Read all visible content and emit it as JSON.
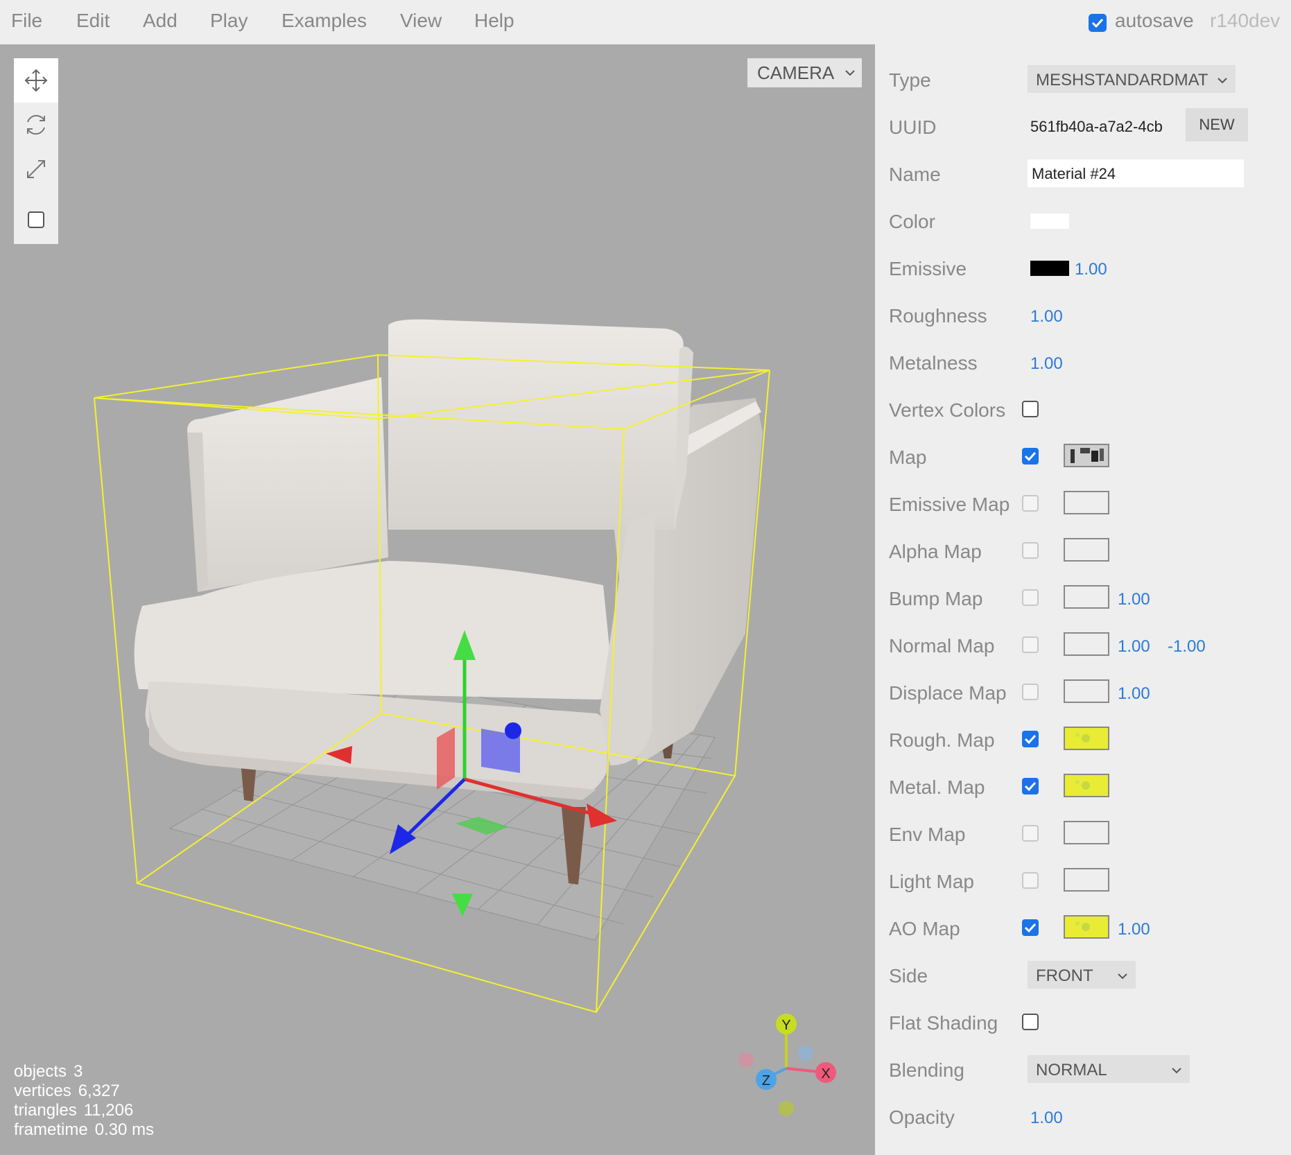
{
  "menubar": {
    "items": [
      "File",
      "Edit",
      "Add",
      "Play",
      "Examples",
      "View",
      "Help"
    ],
    "autosave_label": "autosave",
    "autosave_checked": true,
    "version": "r140dev"
  },
  "viewport": {
    "camera_select": "CAMERA",
    "tools": [
      "translate-icon",
      "rotate-icon",
      "scale-icon",
      "local-checkbox"
    ],
    "info": [
      {
        "label": "objects",
        "value": "3"
      },
      {
        "label": "vertices",
        "value": "6,327"
      },
      {
        "label": "triangles",
        "value": "11,206"
      },
      {
        "label": "frametime",
        "value": "0.30 ms"
      }
    ],
    "axis_labels": {
      "x": "X",
      "y": "Y",
      "z": "Z"
    }
  },
  "material": {
    "type_label": "Type",
    "type_value": "MESHSTANDARDMATI",
    "uuid_label": "UUID",
    "uuid_value": "561fb40a-a7a2-4cb",
    "new_button": "NEW",
    "name_label": "Name",
    "name_value": "Material #24",
    "color_label": "Color",
    "color_value": "#ffffff",
    "emissive_label": "Emissive",
    "emissive_color": "#000000",
    "emissive_intensity": "1.00",
    "roughness_label": "Roughness",
    "roughness_value": "1.00",
    "metalness_label": "Metalness",
    "metalness_value": "1.00",
    "vertex_colors_label": "Vertex Colors",
    "maps": [
      {
        "label": "Map",
        "checked": true,
        "thumb": "map"
      },
      {
        "label": "Emissive Map",
        "checked": false,
        "thumb": "empty"
      },
      {
        "label": "Alpha Map",
        "checked": false,
        "thumb": "empty"
      },
      {
        "label": "Bump Map",
        "checked": false,
        "thumb": "empty",
        "v1": "1.00"
      },
      {
        "label": "Normal Map",
        "checked": false,
        "thumb": "empty",
        "v1": "1.00",
        "v2": "-1.00"
      },
      {
        "label": "Displace Map",
        "checked": false,
        "thumb": "empty",
        "v1": "1.00"
      },
      {
        "label": "Rough. Map",
        "checked": true,
        "thumb": "yellow"
      },
      {
        "label": "Metal. Map",
        "checked": true,
        "thumb": "yellow"
      },
      {
        "label": "Env Map",
        "checked": false,
        "thumb": "empty"
      },
      {
        "label": "Light Map",
        "checked": false,
        "thumb": "empty"
      },
      {
        "label": "AO Map",
        "checked": true,
        "thumb": "yellow",
        "v1": "1.00"
      }
    ],
    "side_label": "Side",
    "side_value": "FRONT",
    "flat_shading_label": "Flat Shading",
    "blending_label": "Blending",
    "blending_value": "NORMAL",
    "opacity_label": "Opacity",
    "opacity_value": "1.00"
  }
}
